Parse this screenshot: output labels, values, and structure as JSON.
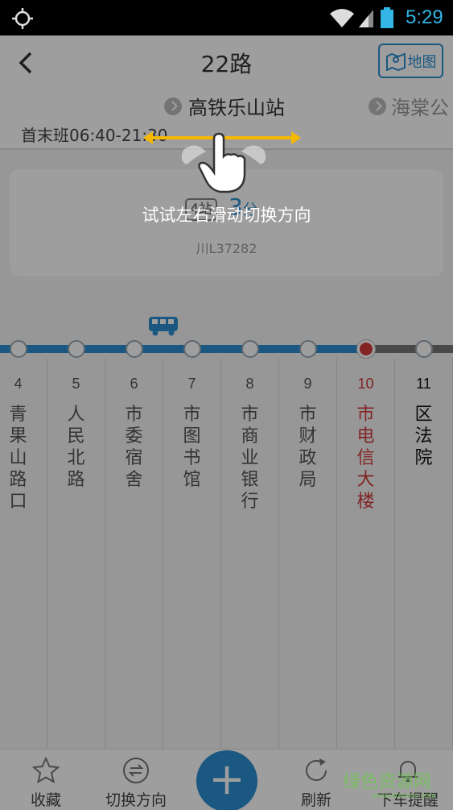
{
  "status_bar": {
    "time": "5:29",
    "accent_color": "#33b5e5"
  },
  "header": {
    "title": "22路",
    "map_button_label": "地图",
    "direction_current": "高铁乐山站",
    "direction_next": "海棠公",
    "service_hours": "首末班06:40-21:30"
  },
  "arrival_card": {
    "stops_away": "4站",
    "minutes_value": "3",
    "minutes_unit": "分",
    "plate_number": "川L37282"
  },
  "stations": [
    {
      "index": "4",
      "name": "青果山路口",
      "state": "passed"
    },
    {
      "index": "5",
      "name": "人民北路",
      "state": "passed"
    },
    {
      "index": "6",
      "name": "市委宿舍",
      "state": "passed"
    },
    {
      "index": "7",
      "name": "市图书馆",
      "state": "passed"
    },
    {
      "index": "8",
      "name": "市商业银行",
      "state": "passed"
    },
    {
      "index": "9",
      "name": "市财政局",
      "state": "passed"
    },
    {
      "index": "10",
      "name": "市电信大楼",
      "state": "current"
    },
    {
      "index": "11",
      "name": "区法院",
      "state": "future"
    }
  ],
  "overlay": {
    "hint_text": "试试左右滑动切换方向"
  },
  "bottom_bar": {
    "favorite_label": "收藏",
    "switch_direction_label": "切换方向",
    "add_label": "+",
    "refresh_label": "刷新",
    "alight_reminder_label": "下车提醒"
  },
  "watermark": {
    "text": "绿色资源网",
    "sub": "www.downcc.com"
  },
  "colors": {
    "primary": "#2a8fd0",
    "current_station": "#d33a3a",
    "route_future": "#777777"
  }
}
